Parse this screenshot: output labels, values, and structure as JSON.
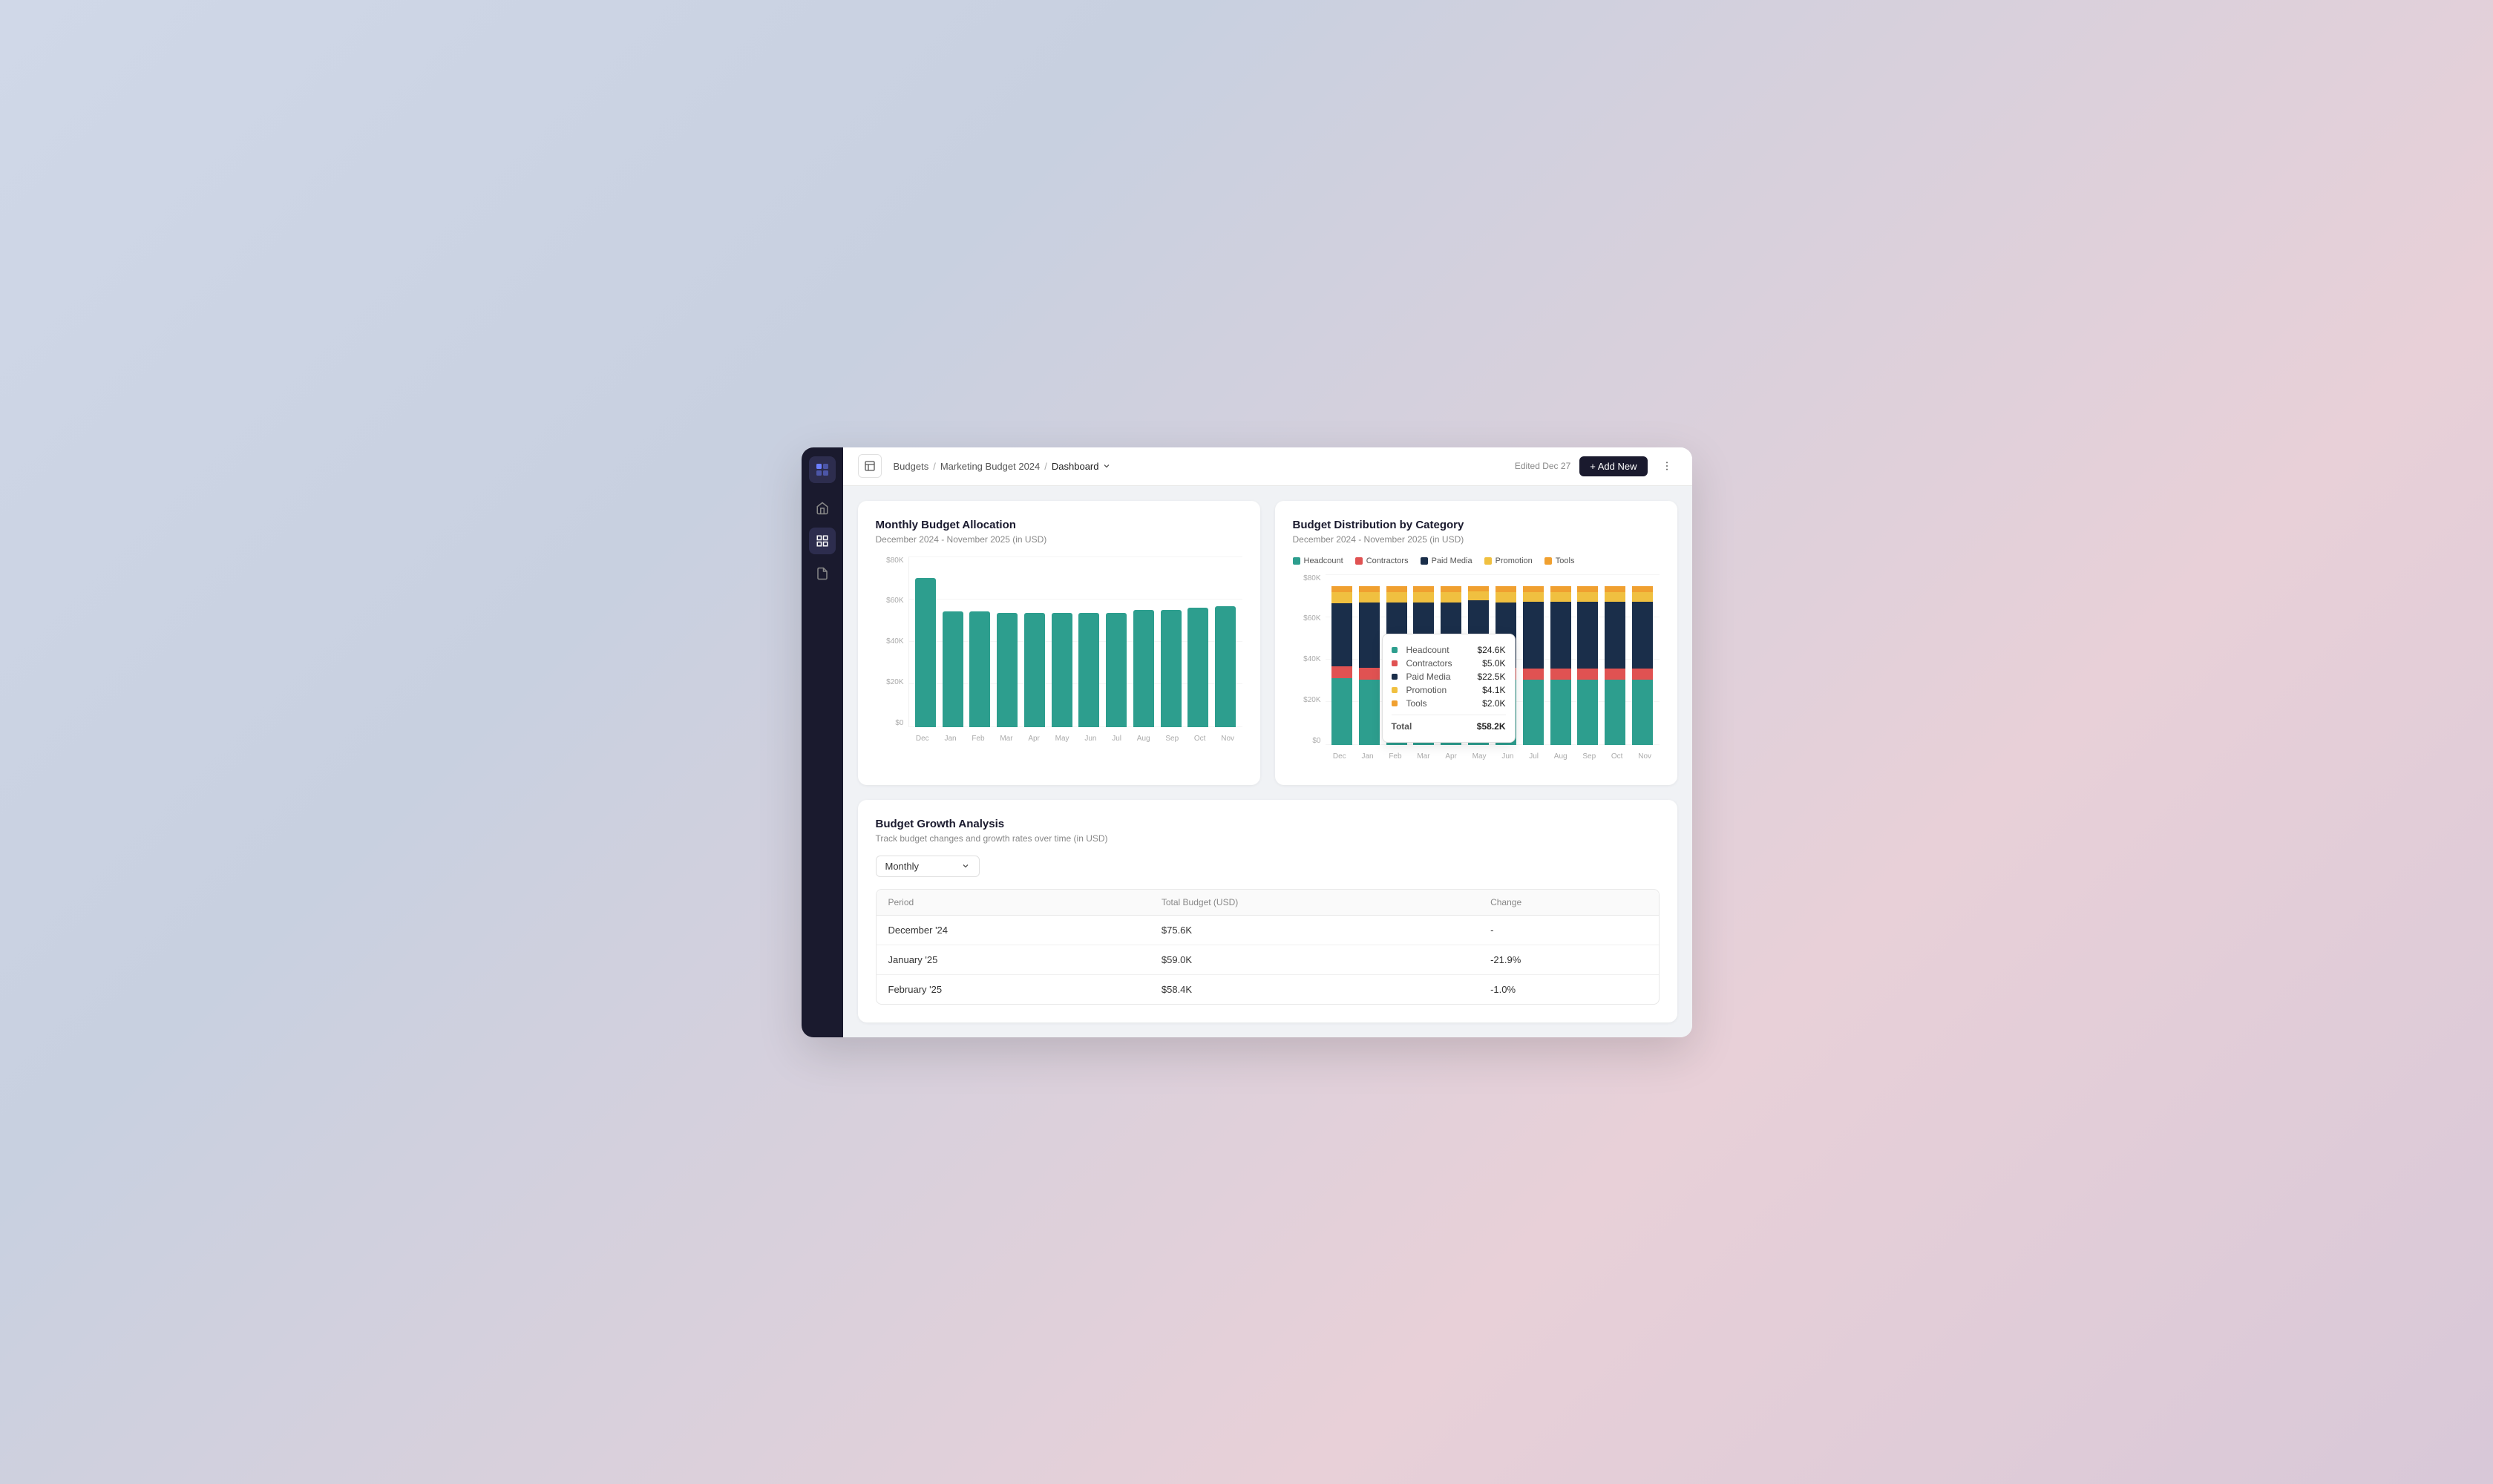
{
  "app": {
    "title": "Marketing Budget 2024",
    "logo_icon": "grid-icon"
  },
  "header": {
    "layout_icon": "layout-icon",
    "breadcrumb": {
      "items": [
        "Budgets",
        "Marketing Budget 2024"
      ],
      "current": "Dashboard",
      "separators": [
        "/",
        "/"
      ]
    },
    "edited_label": "Edited Dec 27",
    "add_new_label": "+ Add New",
    "more_icon": "more-icon"
  },
  "sidebar": {
    "items": [
      {
        "icon": "home-icon",
        "label": "Home",
        "active": false
      },
      {
        "icon": "grid-icon",
        "label": "Grid",
        "active": true
      },
      {
        "icon": "file-icon",
        "label": "File",
        "active": false
      }
    ]
  },
  "monthly_budget_chart": {
    "title": "Monthly Budget Allocation",
    "subtitle": "December 2024 - November 2025 (in USD)",
    "y_labels": [
      "$0",
      "$20K",
      "$40K",
      "$60K",
      "$80K"
    ],
    "bars": [
      {
        "month": "Dec",
        "value": 75600,
        "height_pct": 94
      },
      {
        "month": "Jan",
        "value": 59000,
        "height_pct": 73
      },
      {
        "month": "Feb",
        "value": 58400,
        "height_pct": 73
      },
      {
        "month": "Mar",
        "value": 58200,
        "height_pct": 72
      },
      {
        "month": "Apr",
        "value": 58200,
        "height_pct": 72
      },
      {
        "month": "May",
        "value": 58200,
        "height_pct": 72
      },
      {
        "month": "Jun",
        "value": 58200,
        "height_pct": 72
      },
      {
        "month": "Jul",
        "value": 58200,
        "height_pct": 72
      },
      {
        "month": "Aug",
        "value": 59800,
        "height_pct": 74
      },
      {
        "month": "Sep",
        "value": 59800,
        "height_pct": 74
      },
      {
        "month": "Oct",
        "value": 60400,
        "height_pct": 75
      },
      {
        "month": "Nov",
        "value": 61000,
        "height_pct": 76
      }
    ]
  },
  "distribution_chart": {
    "title": "Budget Distribution by Category",
    "subtitle": "December 2024 - November 2025 (in USD)",
    "legend": [
      {
        "label": "Headcount",
        "color": "#2d9e8e"
      },
      {
        "label": "Contractors",
        "color": "#e05252"
      },
      {
        "label": "Paid Media",
        "color": "#1a2e4a"
      },
      {
        "label": "Promotion",
        "color": "#f0c040"
      },
      {
        "label": "Tools",
        "color": "#f0a030"
      }
    ],
    "tooltip": {
      "headcount": "$24.6K",
      "contractors": "$5.0K",
      "paid_media": "$22.5K",
      "promotion": "$4.1K",
      "tools": "$2.0K",
      "total": "$58.2K"
    },
    "bars": [
      {
        "month": "Dec",
        "headcount": 90,
        "contractors": 16,
        "paid_media": 85,
        "promotion": 15,
        "tools": 8
      },
      {
        "month": "Jan",
        "headcount": 65,
        "contractors": 12,
        "paid_media": 65,
        "promotion": 10,
        "tools": 6
      },
      {
        "month": "Feb",
        "headcount": 65,
        "contractors": 12,
        "paid_media": 65,
        "promotion": 10,
        "tools": 6
      },
      {
        "month": "Mar",
        "headcount": 65,
        "contractors": 12,
        "paid_media": 65,
        "promotion": 10,
        "tools": 6
      },
      {
        "month": "Apr",
        "headcount": 65,
        "contractors": 12,
        "paid_media": 65,
        "promotion": 10,
        "tools": 6
      },
      {
        "month": "May",
        "headcount": 60,
        "contractors": 10,
        "paid_media": 60,
        "promotion": 8,
        "tools": 5
      },
      {
        "month": "Jun",
        "headcount": 65,
        "contractors": 12,
        "paid_media": 65,
        "promotion": 10,
        "tools": 6
      },
      {
        "month": "Jul",
        "headcount": 68,
        "contractors": 12,
        "paid_media": 70,
        "promotion": 10,
        "tools": 6
      },
      {
        "month": "Aug",
        "headcount": 68,
        "contractors": 12,
        "paid_media": 70,
        "promotion": 10,
        "tools": 6
      },
      {
        "month": "Sep",
        "headcount": 68,
        "contractors": 12,
        "paid_media": 70,
        "promotion": 10,
        "tools": 6
      },
      {
        "month": "Oct",
        "headcount": 68,
        "contractors": 12,
        "paid_media": 70,
        "promotion": 10,
        "tools": 6
      },
      {
        "month": "Nov",
        "headcount": 68,
        "contractors": 12,
        "paid_media": 70,
        "promotion": 10,
        "tools": 6
      }
    ]
  },
  "growth_analysis": {
    "title": "Budget Growth Analysis",
    "subtitle": "Track budget changes and growth rates over time (in USD)",
    "dropdown_label": "Monthly",
    "table": {
      "columns": [
        "Period",
        "Total Budget (USD)",
        "Change"
      ],
      "rows": [
        {
          "period": "December '24",
          "budget": "$75.6K",
          "change": "-",
          "change_type": "neutral"
        },
        {
          "period": "January '25",
          "budget": "$59.0K",
          "change": "-21.9%",
          "change_type": "negative"
        },
        {
          "period": "February '25",
          "budget": "$58.4K",
          "change": "-1.0%",
          "change_type": "negative"
        }
      ]
    }
  }
}
